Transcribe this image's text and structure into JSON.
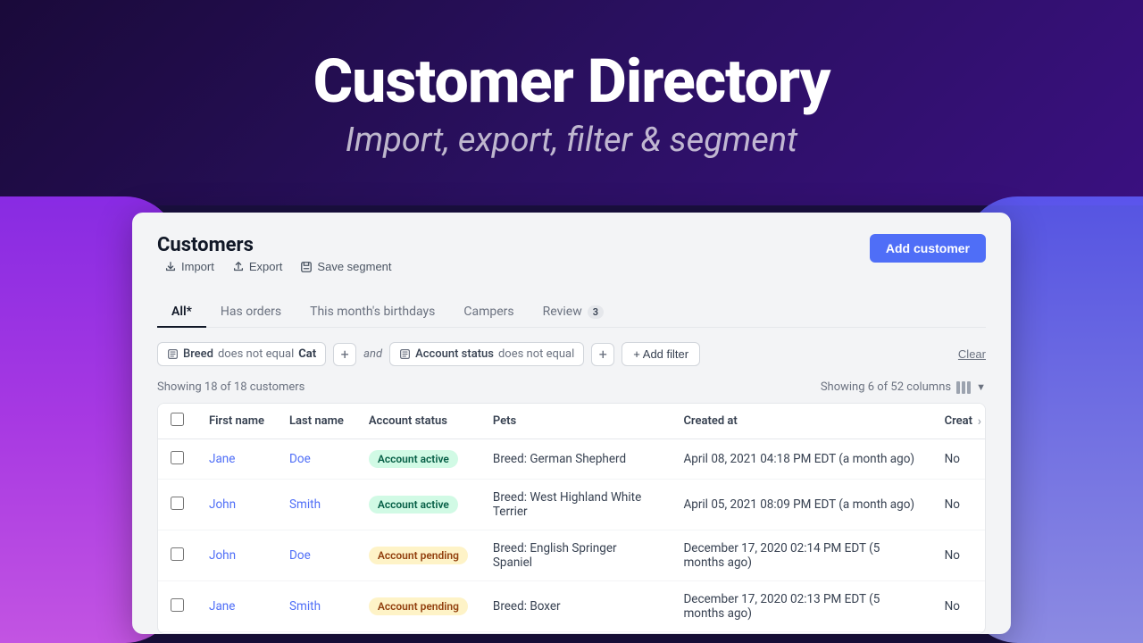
{
  "hero": {
    "title": "Customer Directory",
    "subtitle": "Import, export, filter & segment"
  },
  "page": {
    "title": "Customers",
    "add_button": "Add customer"
  },
  "toolbar": {
    "import": "Import",
    "export": "Export",
    "save_segment": "Save segment"
  },
  "tabs": [
    {
      "id": "all",
      "label": "All*",
      "active": true,
      "badge": null
    },
    {
      "id": "has_orders",
      "label": "Has orders",
      "active": false,
      "badge": null
    },
    {
      "id": "birthdays",
      "label": "This month's birthdays",
      "active": false,
      "badge": null
    },
    {
      "id": "campers",
      "label": "Campers",
      "active": false,
      "badge": null
    },
    {
      "id": "review",
      "label": "Review",
      "active": false,
      "badge": "3"
    }
  ],
  "filters": {
    "breed_label": "Breed",
    "breed_operator": "does not equal",
    "breed_value": "Cat",
    "status_label": "Account status",
    "status_operator": "does not equal",
    "and_label": "and",
    "add_filter": "+ Add filter",
    "clear": "Clear"
  },
  "table": {
    "showing_text": "Showing 18 of 18 customers",
    "columns_text": "Showing 6 of 52 columns",
    "headers": [
      "",
      "First name",
      "Last name",
      "Account status",
      "Pets",
      "Created at",
      "Creat"
    ],
    "rows": [
      {
        "first_name": "Jane",
        "last_name": "Doe",
        "status": "Account active",
        "status_type": "active",
        "pets": "Breed: German Shepherd",
        "created_at": "April 08, 2021 04:18 PM EDT (a month ago)",
        "extra": "No"
      },
      {
        "first_name": "John",
        "last_name": "Smith",
        "status": "Account active",
        "status_type": "active",
        "pets": "Breed: West Highland White Terrier",
        "created_at": "April 05, 2021 08:09 PM EDT (a month ago)",
        "extra": "No"
      },
      {
        "first_name": "John",
        "last_name": "Doe",
        "status": "Account pending",
        "status_type": "pending",
        "pets": "Breed: English Springer Spaniel",
        "created_at": "December 17, 2020 02:14 PM EDT (5 months ago)",
        "extra": "No"
      },
      {
        "first_name": "Jane",
        "last_name": "Smith",
        "status": "Account pending",
        "status_type": "pending",
        "pets": "Breed: Boxer",
        "created_at": "December 17, 2020 02:13 PM EDT (5 months ago)",
        "extra": "No"
      }
    ]
  }
}
